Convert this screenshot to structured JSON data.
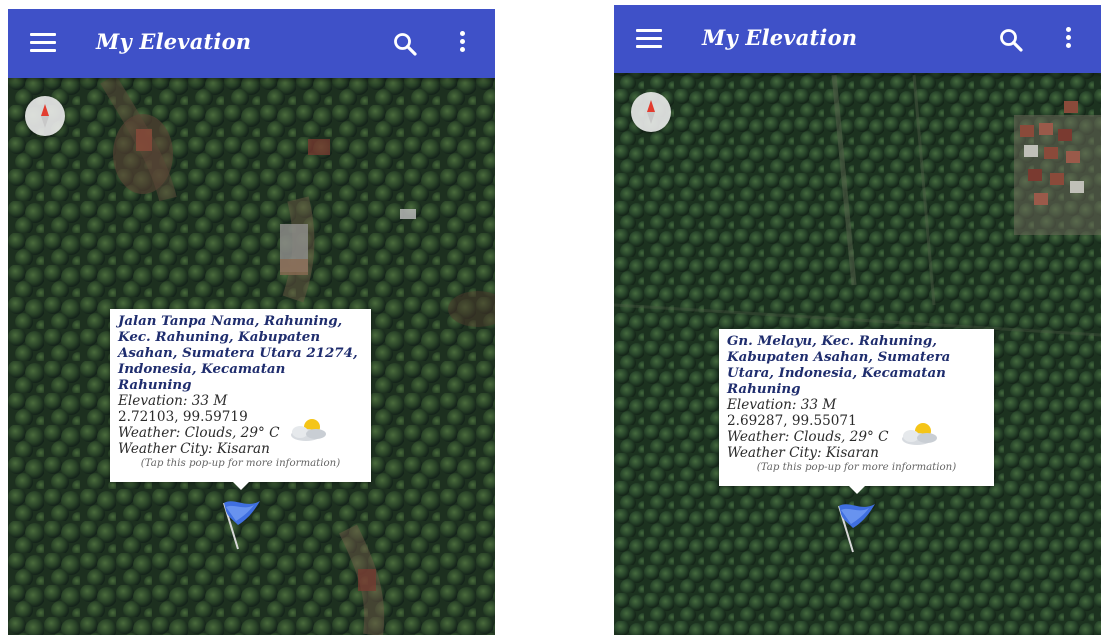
{
  "colors": {
    "appbar": "#3f51c8",
    "address_text": "#1f2d6e",
    "popup_bg": "#ffffff",
    "map_dark": "#1f3320"
  },
  "screens": [
    {
      "appbar": {
        "title": "My Elevation",
        "menu_icon": "hamburger-menu-icon",
        "search_icon": "search-icon",
        "more_icon": "more-vertical-icon"
      },
      "compass_icon": "compass-icon",
      "popup": {
        "address": "Jalan Tanpa Nama, Rahuning, Kec. Rahuning, Kabupaten Asahan, Sumatera Utara 21274, Indonesia, Kecamatan Rahuning",
        "elevation": "Elevation: 33 M",
        "coordinates": "2.72103, 99.59719",
        "weather": "Weather: Clouds,  29° C",
        "weather_icon": "partly-cloudy-icon",
        "weather_city": "Weather City: Kisaran",
        "hint": "(Tap this pop-up for more information)"
      },
      "marker_icon": "blue-flag-icon"
    },
    {
      "appbar": {
        "title": "My Elevation",
        "menu_icon": "hamburger-menu-icon",
        "search_icon": "search-icon",
        "more_icon": "more-vertical-icon"
      },
      "compass_icon": "compass-icon",
      "popup": {
        "address": "Gn. Melayu, Kec. Rahuning, Kabupaten Asahan, Sumatera Utara, Indonesia, Kecamatan Rahuning",
        "elevation": "Elevation: 33 M",
        "coordinates": "2.69287, 99.55071",
        "weather": "Weather: Clouds,  29° C",
        "weather_icon": "partly-cloudy-icon",
        "weather_city": "Weather City: Kisaran",
        "hint": "(Tap this pop-up for more information)"
      },
      "marker_icon": "blue-flag-icon"
    }
  ]
}
